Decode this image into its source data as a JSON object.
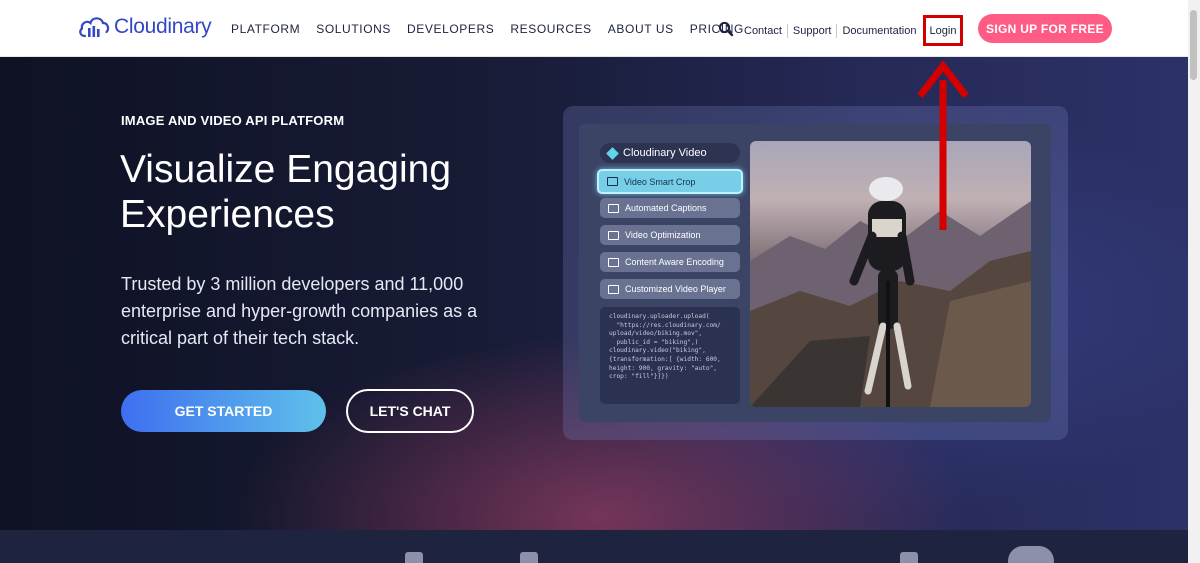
{
  "header": {
    "logo_text": "Cloudinary",
    "nav": [
      "PLATFORM",
      "SOLUTIONS",
      "DEVELOPERS",
      "RESOURCES",
      "ABOUT US",
      "PRICING"
    ],
    "secondary": [
      "Contact",
      "Support",
      "Documentation"
    ],
    "login": "Login",
    "signup": "SIGN UP FOR FREE"
  },
  "hero": {
    "eyebrow": "IMAGE AND VIDEO API PLATFORM",
    "headline": "Visualize Engaging Experiences",
    "subtext": "Trusted by 3 million developers and 11,000 enterprise and hyper-growth companies as a critical part of their tech stack.",
    "cta_primary": "GET STARTED",
    "cta_secondary": "LET'S CHAT"
  },
  "demo": {
    "title": "Cloudinary Video",
    "features": [
      "Video Smart Crop",
      "Automated Captions",
      "Video Optimization",
      "Content Aware Encoding",
      "Customized Video Player"
    ],
    "code": [
      "cloudinary.uploader.upload(",
      "  \"https://res.cloudinary.com/",
      "upload/video/biking.mov\",",
      "  public_id = \"biking\",)",
      "",
      "cloudinary.video(\"biking\",",
      "{transformation:[ {width: 600,",
      "height: 900, gravity: \"auto\",",
      "crop: \"fill\"}]})"
    ]
  },
  "colors": {
    "brand_blue": "#3448c5",
    "signup_pink": "#ff5c85",
    "annotation_red": "#d40000",
    "hero_dark": "#171b35"
  },
  "icons": {
    "search": "search-icon",
    "logo": "cloud-logo-icon"
  }
}
